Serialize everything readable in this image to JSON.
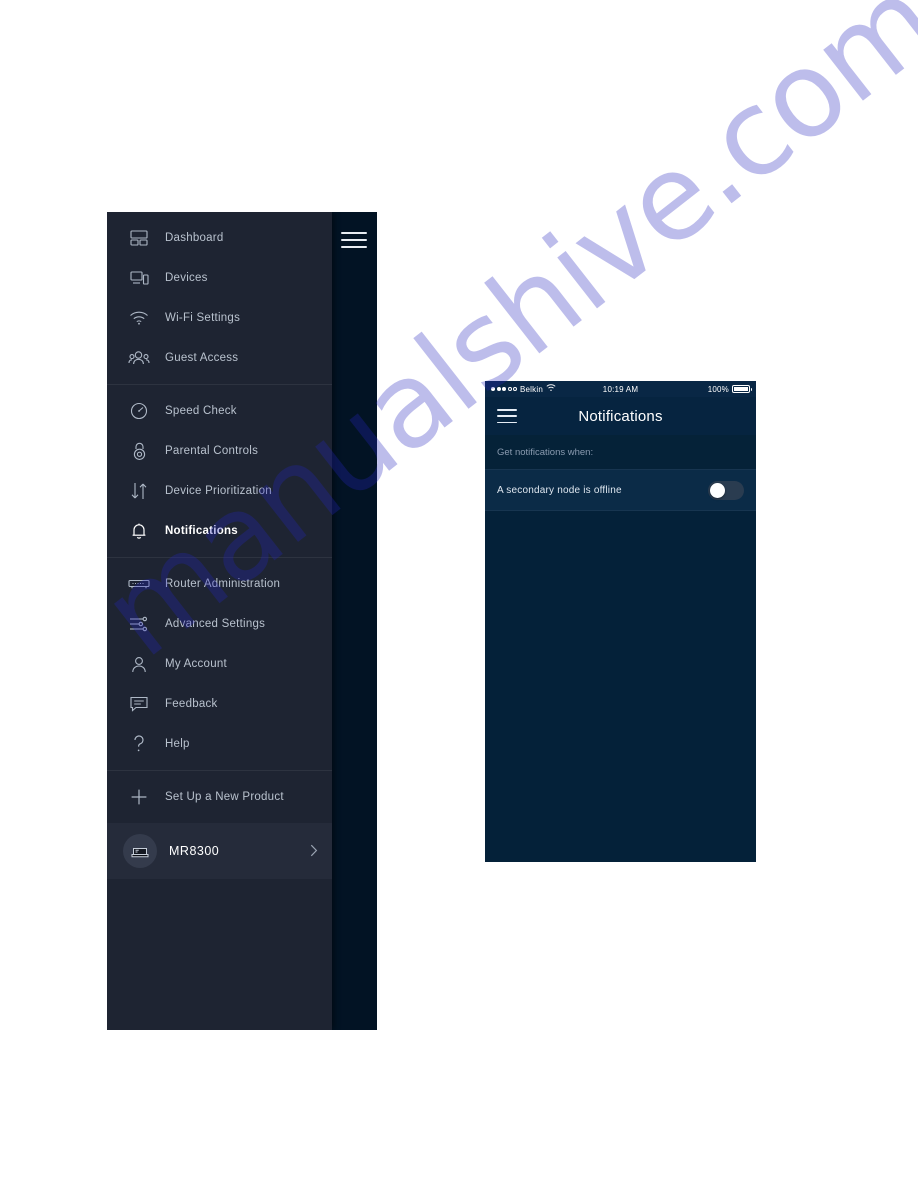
{
  "watermark": {
    "text": "manualshive.com"
  },
  "sidebar": {
    "hamburger_icon": "hamburger-menu-icon",
    "groups": [
      {
        "items": [
          {
            "label": "Dashboard",
            "icon": "dashboard-icon",
            "active": false
          },
          {
            "label": "Devices",
            "icon": "devices-icon",
            "active": false
          },
          {
            "label": "Wi-Fi Settings",
            "icon": "wifi-icon",
            "active": false
          },
          {
            "label": "Guest Access",
            "icon": "guest-access-icon",
            "active": false
          }
        ]
      },
      {
        "items": [
          {
            "label": "Speed Check",
            "icon": "speedometer-icon",
            "active": false
          },
          {
            "label": "Parental Controls",
            "icon": "lock-icon",
            "active": false
          },
          {
            "label": "Device Prioritization",
            "icon": "up-down-arrows-icon",
            "active": false
          },
          {
            "label": "Notifications",
            "icon": "bell-icon",
            "active": true
          }
        ]
      },
      {
        "items": [
          {
            "label": "Router Administration",
            "icon": "router-icon",
            "active": false
          },
          {
            "label": "Advanced Settings",
            "icon": "sliders-icon",
            "active": false
          },
          {
            "label": "My Account",
            "icon": "user-icon",
            "active": false
          },
          {
            "label": "Feedback",
            "icon": "chat-bubble-icon",
            "active": false
          },
          {
            "label": "Help",
            "icon": "question-mark-icon",
            "active": false
          }
        ]
      },
      {
        "items": [
          {
            "label": "Set Up a New Product",
            "icon": "plus-icon",
            "active": false
          }
        ]
      }
    ],
    "product": {
      "name": "MR8300",
      "avatar_icon": "router-device-icon",
      "chevron_icon": "chevron-right-icon"
    },
    "colors": {
      "background": "#1e2432",
      "underlay": "#021324",
      "active_text": "#ffffff",
      "text": "#b9c2ce"
    }
  },
  "phone": {
    "status_bar": {
      "signal_icon": "signal-dots-icon",
      "carrier": "Belkin",
      "wifi_icon": "wifi-icon",
      "time": "10:19 AM",
      "battery_percent": "100%",
      "battery_icon": "battery-full-icon"
    },
    "header": {
      "menu_icon": "hamburger-menu-icon",
      "title": "Notifications"
    },
    "subheading": "Get notifications when:",
    "rows": [
      {
        "label": "A secondary node is offline",
        "toggle_state": "off",
        "toggle_icon": "toggle-switch-off-icon"
      }
    ],
    "colors": {
      "background": "#042139",
      "row_background": "#0b2b47",
      "accent": "#ffffff"
    }
  }
}
